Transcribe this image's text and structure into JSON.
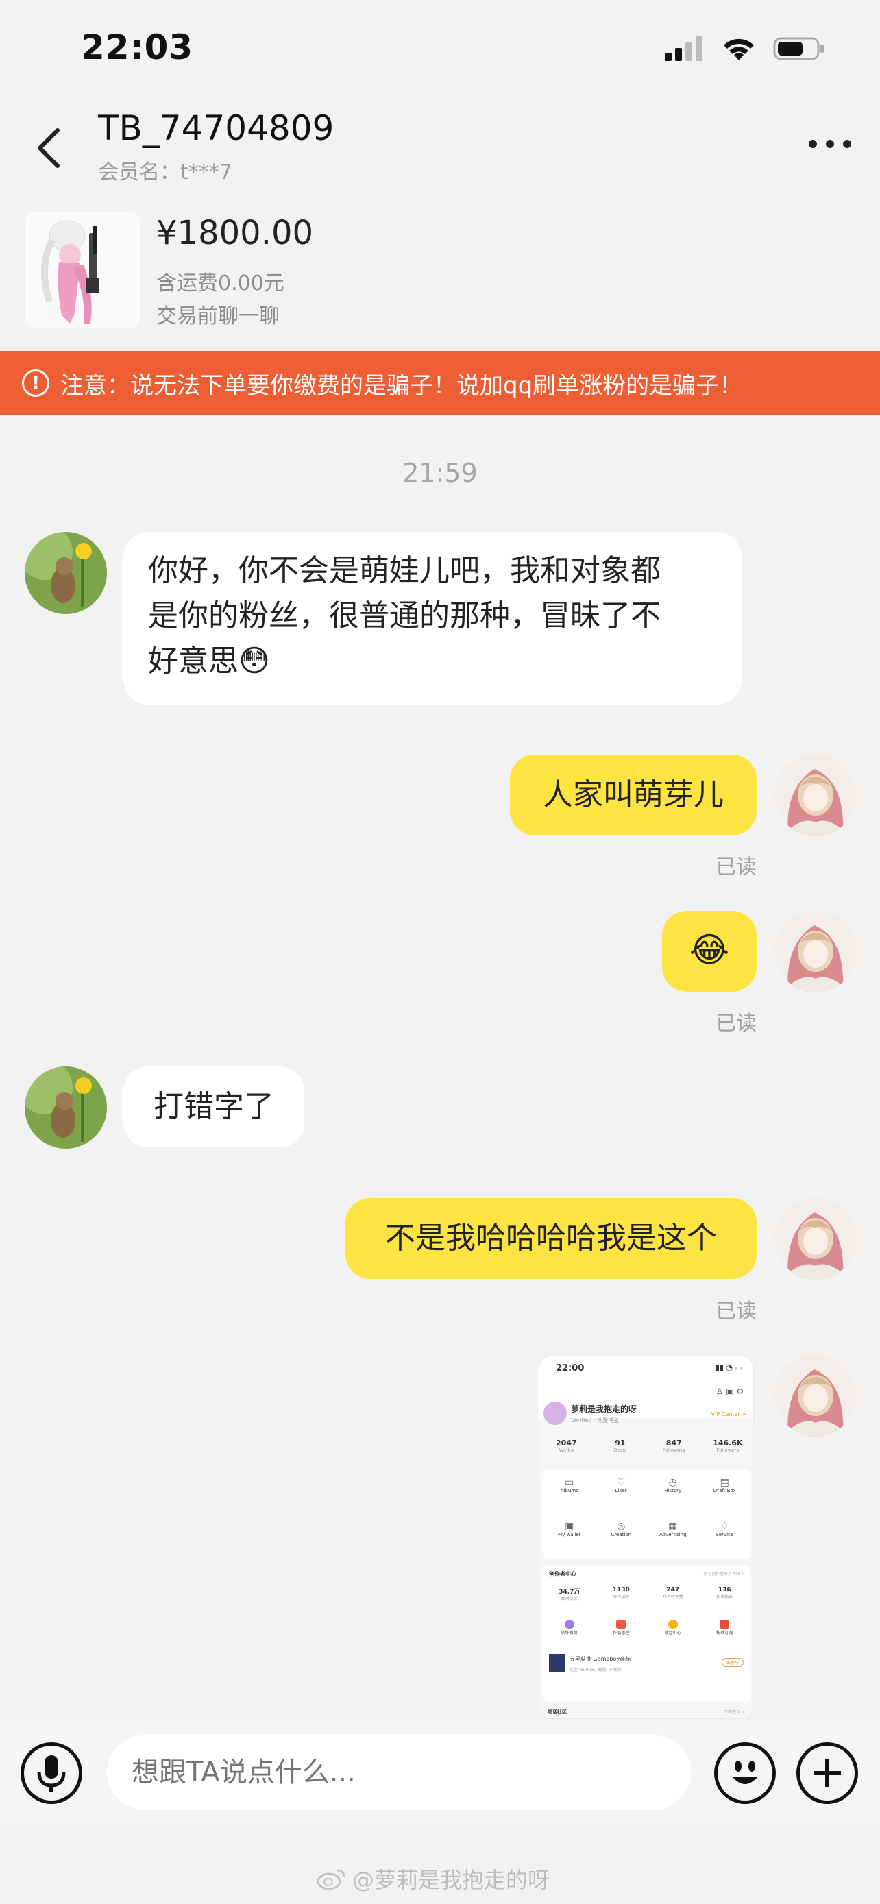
{
  "status_bar": {
    "time": "22:03"
  },
  "header": {
    "title": "TB_74704809",
    "subtitle": "会员名：t***7"
  },
  "product": {
    "price": "¥1800.00",
    "shipping": "含运费0.00元",
    "note": "交易前聊一聊"
  },
  "warning": {
    "text": "注意：说无法下单要你缴费的是骗子！说加qq刷单涨粉的是骗子！"
  },
  "chat": {
    "timestamp": "21:59",
    "messages": [
      {
        "side": "left",
        "lines": [
          "你好，你不会是萌娃儿吧，我和对象都",
          "是你的粉丝，很普通的那种，冒昧了不",
          "好意思😳"
        ]
      },
      {
        "side": "right",
        "text": "人家叫萌芽儿",
        "status": "已读"
      },
      {
        "side": "right",
        "text": "😂",
        "status": "已读"
      },
      {
        "side": "left",
        "text": "打错字了"
      },
      {
        "side": "right",
        "text": "不是我哈哈哈哈我是这个",
        "status": "已读"
      }
    ]
  },
  "screenshot_msg": {
    "time": "22:00",
    "name": "萝莉是我抱走的呀",
    "verified": "Verified · 动漫博主",
    "vip": "VIP Center >",
    "stats": [
      {
        "value": "2047",
        "label": "Weibo"
      },
      {
        "value": "91",
        "label": "Oasis"
      },
      {
        "value": "847",
        "label": "Following"
      },
      {
        "value": "146.6K",
        "label": "Followers"
      }
    ],
    "grid": [
      "Albums",
      "Likes",
      "History",
      "Draft Box",
      "My wallet",
      "Creation",
      "Advertising",
      "Service"
    ],
    "creator_title": "创作者中心",
    "creator_link": "参与创作者官方补贴 >",
    "creator_stats": [
      {
        "value": "34.7万",
        "label": "昨日阅读"
      },
      {
        "value": "1130",
        "label": "昨日播放"
      },
      {
        "value": "247",
        "label": "昨日转评赞"
      },
      {
        "value": "136",
        "label": "新增粉丝"
      }
    ],
    "creator_tools": [
      "创作首页",
      "作品管理",
      "收益中心",
      "粉丝订阅"
    ],
    "promo_title": "五星获批 Gameboy商标",
    "promo_sub": "奖金: 5000元, 截期: 不限制",
    "promo_btn": "去参与",
    "community": "超话社区",
    "community_link": "立即签到 >"
  },
  "input_bar": {
    "placeholder": "想跟TA说点什么..."
  },
  "watermark": {
    "text": "@萝莉是我抱走的呀"
  },
  "colors": {
    "accent_warning": "#ee5e34",
    "bubble_right": "#fde443",
    "background": "#f2f2f2"
  }
}
